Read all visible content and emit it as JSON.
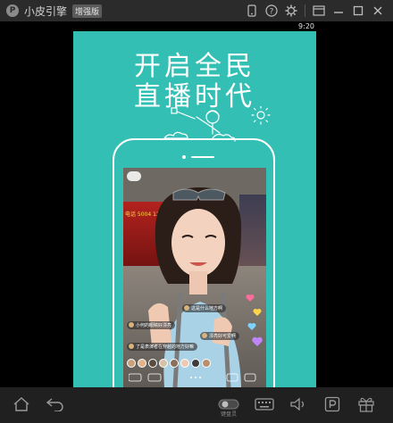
{
  "titlebar": {
    "app_title": "小皮引擎",
    "edition_badge": "增强版",
    "icons": [
      "phone-icon",
      "help-icon",
      "gear-icon",
      "skin-icon",
      "minimize-icon",
      "maximize-icon",
      "close-icon"
    ]
  },
  "statusbar": {
    "clock": "9:20"
  },
  "screen": {
    "headline_line1": "开启全民",
    "headline_line2": "直播时代",
    "background_color": "#33bfb4",
    "live_preview": {
      "shop_sign": "电话 5004 1220",
      "comments": [
        "这是什么地方啊",
        "小何的眼睛好漂亮",
        "漂亮好可爱啊",
        "了是表演者在穿越的地方好嘛"
      ]
    }
  },
  "toolbar": {
    "icons": [
      "home-icon",
      "back-icon",
      "toggle-icon",
      "keyboard-icon",
      "volume-icon",
      "parking-icon",
      "gift-icon"
    ],
    "toggle_caption": "键盘灵"
  }
}
